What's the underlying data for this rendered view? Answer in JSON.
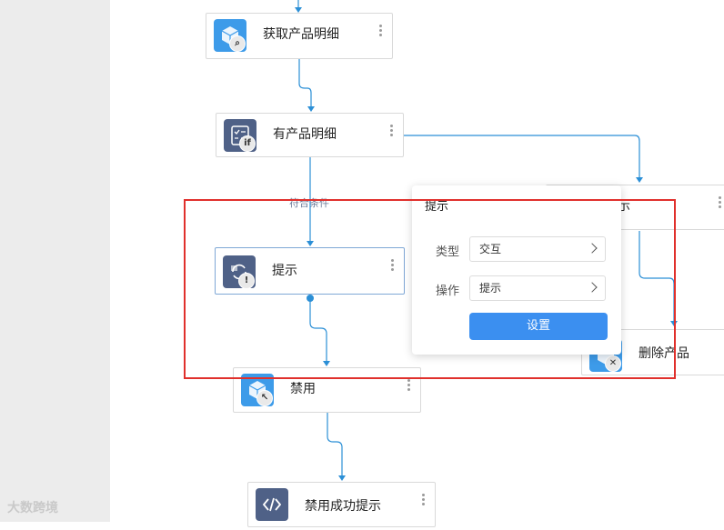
{
  "nodes": {
    "get_product_detail": {
      "label": "获取产品明细",
      "icon": "cube-search-icon"
    },
    "has_product_detail": {
      "label": "有产品明细",
      "icon": "checklist-if-icon"
    },
    "tip": {
      "label": "提示",
      "icon": "refresh-alert-icon"
    },
    "disable": {
      "label": "禁用",
      "icon": "cube-cursor-icon"
    },
    "disable_success_tip": {
      "label": "禁用成功提示",
      "icon": "code-icon"
    },
    "delete_product": {
      "label": "删除产品",
      "icon": "cube-close-icon"
    },
    "partial_right_label": "示"
  },
  "condition_label": "符合条件",
  "popup": {
    "title": "提示",
    "type_label": "类型",
    "type_value": "交互",
    "action_label": "操作",
    "action_value": "提示",
    "settings_button": "设置"
  },
  "watermark": "大数跨境",
  "colors": {
    "accent": "#3b8ff0",
    "highlight_box": "#e0302c",
    "connector": "#2b8fd6"
  }
}
